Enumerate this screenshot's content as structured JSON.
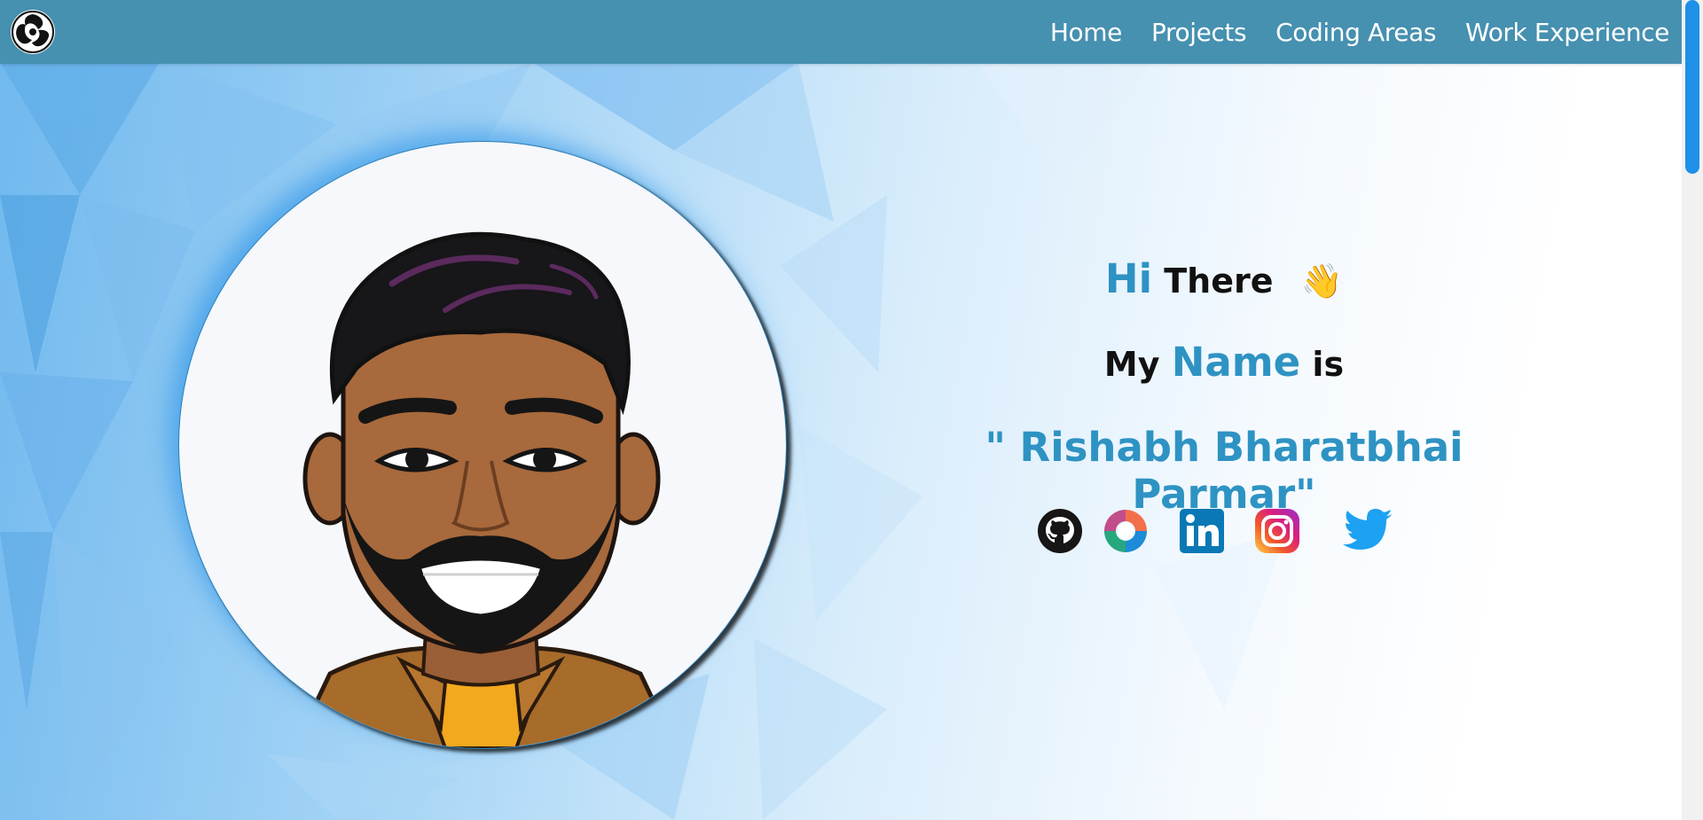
{
  "nav": {
    "logo_icon": "swirl-logo-icon",
    "links": [
      "Home",
      "Projects",
      "Coding Areas",
      "Work Experience"
    ]
  },
  "intro": {
    "hi": "Hi",
    "there": "There",
    "wave": "👋",
    "my": "My",
    "name_word": "Name",
    "is": "is",
    "full_name": "\" Rishabh Bharatbhai Parmar\""
  },
  "socials": [
    {
      "name": "github-icon",
      "color": "#171515"
    },
    {
      "name": "sololearn-icon",
      "color": "#1d8cd7"
    },
    {
      "name": "linkedin-icon",
      "color": "#0a78b5"
    },
    {
      "name": "instagram-icon",
      "color": "#e1306c"
    },
    {
      "name": "twitter-icon",
      "color": "#1da1f2"
    }
  ],
  "colors": {
    "navbar": "#4690b0",
    "accent": "#2e93c3",
    "scroll_thumb": "#1e90e8"
  }
}
